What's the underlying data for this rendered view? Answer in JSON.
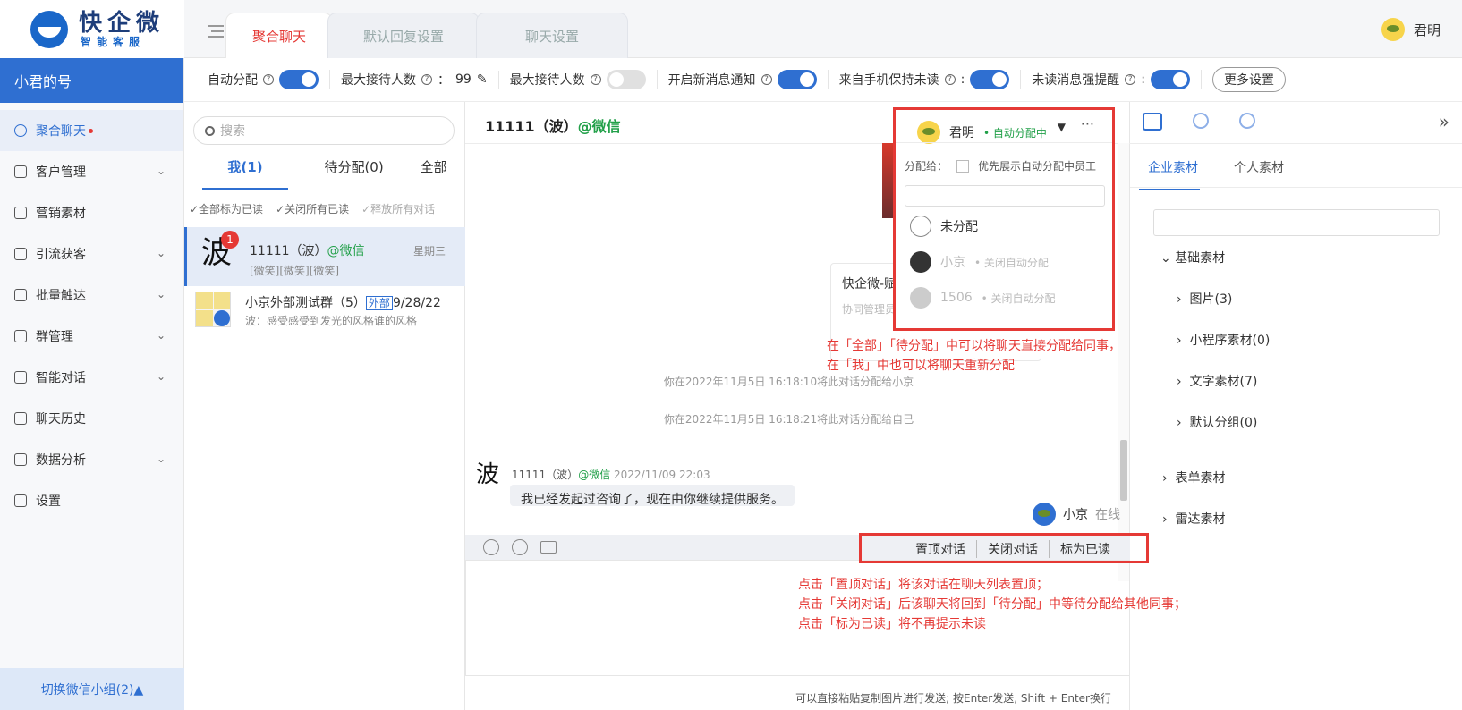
{
  "brand": {
    "name": "快企微",
    "tagline": "智能客服"
  },
  "tabs": [
    {
      "label": "聚合聊天",
      "active": true
    },
    {
      "label": "默认回复设置",
      "active": false
    },
    {
      "label": "聊天设置",
      "active": false
    }
  ],
  "user": {
    "name": "君明"
  },
  "account": {
    "label": "小君的号"
  },
  "nav": [
    {
      "label": "聚合聊天",
      "icon": "chat-icon",
      "active": true,
      "unread_dot": true
    },
    {
      "label": "客户管理",
      "icon": "customer-icon",
      "expandable": true
    },
    {
      "label": "营销素材",
      "icon": "folder-icon",
      "expandable": false
    },
    {
      "label": "引流获客",
      "icon": "user-add-icon",
      "expandable": true
    },
    {
      "label": "批量触达",
      "icon": "funnel-icon",
      "expandable": true
    },
    {
      "label": "群管理",
      "icon": "group-icon",
      "expandable": true
    },
    {
      "label": "智能对话",
      "icon": "bulb-icon",
      "expandable": true
    },
    {
      "label": "聊天历史",
      "icon": "history-icon",
      "expandable": false
    },
    {
      "label": "数据分析",
      "icon": "chart-icon",
      "expandable": true
    },
    {
      "label": "设置",
      "icon": "gear-icon",
      "expandable": false
    }
  ],
  "switch_group": {
    "label": "切换微信小组(2)▲"
  },
  "settings": {
    "auto_assign": {
      "label": "自动分配",
      "on": true
    },
    "max_receive": {
      "label": "最大接待人数",
      "value": "99"
    },
    "max_receive_toggle": {
      "label": "最大接待人数",
      "on": false
    },
    "new_msg_notify": {
      "label": "开启新消息通知",
      "on": true
    },
    "phone_unread": {
      "label": "来自手机保持未读",
      "on": true
    },
    "unread_remind": {
      "label": "未读消息强提醒",
      "on": true
    },
    "more": "更多设置"
  },
  "conv_panel": {
    "search_placeholder": "搜索",
    "tabs": [
      {
        "label": "我(1)",
        "active": true
      },
      {
        "label": "待分配(0)"
      },
      {
        "label": "全部"
      }
    ],
    "actions": [
      "✓全部标为已读",
      "✓关闭所有已读",
      "✓释放所有对话"
    ],
    "items": [
      {
        "avatar_char": "波",
        "unread": "1",
        "name": "11111（波）",
        "source": "@微信",
        "preview": "[微笑][微笑][微笑]",
        "time": "星期三"
      },
      {
        "name": "小京外部测试群（5）",
        "tag": "外部",
        "time": "9/28/22",
        "preview": "波：感受感受到发光的风格谁的风格"
      }
    ]
  },
  "chat": {
    "title": "11111（波）",
    "source": "@微信",
    "card": {
      "title": "快企微-赋",
      "desc": "协同管理员 接"
    },
    "system_msgs": [
      "你在2022年11月5日 16:18:10将此对话分配给小京",
      "你在2022年11月5日 16:18:21将此对话分配给自己"
    ],
    "message": {
      "sender": "11111（波）",
      "source": "@微信",
      "time": "2022/11/09 22:03",
      "text": "我已经发起过咨询了，现在由你继续提供服务。",
      "avatar_char": "波"
    },
    "agent": {
      "name": "小京",
      "status": "在线"
    },
    "toolbar_actions": [
      "置顶对话",
      "关闭对话",
      "标为已读"
    ],
    "hint": "可以直接粘贴复制图片进行发送; 按Enter发送, Shift + Enter换行"
  },
  "assign_popup": {
    "current": "君明",
    "current_status": "• 自动分配中",
    "assign_to": "分配给：",
    "priority_label": "优先展示自动分配中员工",
    "options": [
      {
        "name": "未分配",
        "status": ""
      },
      {
        "name": "小京",
        "status": "• 关闭自动分配"
      },
      {
        "name": "1506",
        "status": "• 关闭自动分配"
      }
    ]
  },
  "right_panel": {
    "tabs": [
      {
        "label": "企业素材",
        "active": true
      },
      {
        "label": "个人素材"
      }
    ],
    "tree": [
      {
        "label": "基础素材",
        "open": true,
        "level": 0
      },
      {
        "label": "图片(3)",
        "level": 1
      },
      {
        "label": "小程序素材(0)",
        "level": 1
      },
      {
        "label": "文字素材(7)",
        "level": 1
      },
      {
        "label": "默认分组(0)",
        "level": 1
      },
      {
        "label": "表单素材",
        "level": 0
      },
      {
        "label": "雷达素材",
        "level": 0
      }
    ]
  },
  "annotations": {
    "assign_note": [
      "在「全部」「待分配」中可以将聊天直接分配给同事，",
      "在「我」中也可以将聊天重新分配"
    ],
    "toolbar_note": [
      "点击「置顶对话」将该对话在聊天列表置顶；",
      "点击「关闭对话」后该聊天将回到「待分配」中等待分配给其他同事；",
      "点击「标为已读」将不再提示未读"
    ]
  },
  "colors": {
    "accent": "#2f6fd1",
    "alert": "#e53935",
    "wechat": "#22a049"
  }
}
